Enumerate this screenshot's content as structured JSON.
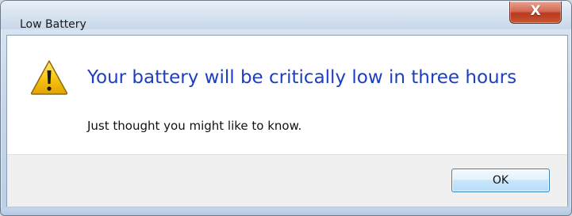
{
  "window": {
    "title": "Low Battery",
    "close_label": "X"
  },
  "dialog": {
    "main_instruction": "Your battery will be critically low in three hours",
    "sub_text": "Just thought you might like to know.",
    "ok_label": "OK",
    "icon": "warning-icon"
  },
  "colors": {
    "instruction": "#1d3fbf",
    "close_button": "#c9552f",
    "warning_yellow": "#f6c400"
  }
}
